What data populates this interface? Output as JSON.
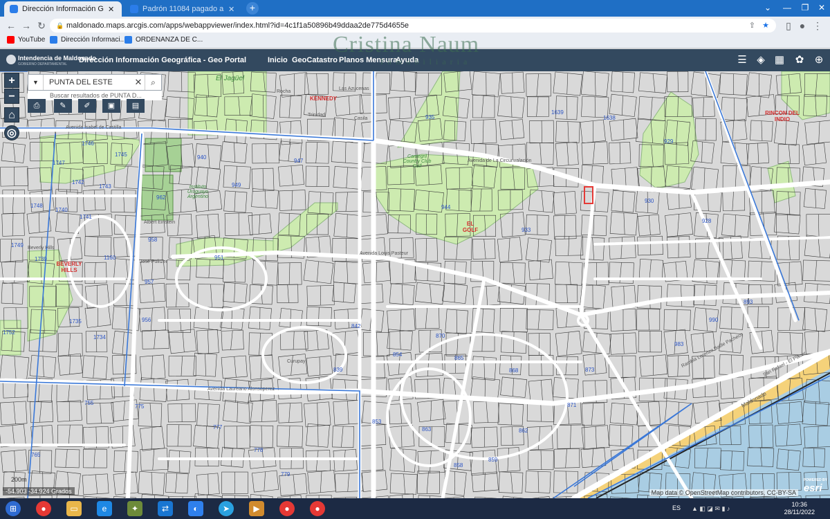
{
  "browser": {
    "tabs": [
      {
        "label": "Dirección Información Geográfica",
        "active": true
      },
      {
        "label": "Padrón 11084 pagado a su favor",
        "active": false
      }
    ],
    "url": "maldonado.maps.arcgis.com/apps/webappviewer/index.html?id=4c1f1a50896b49ddaa2de775d4655e",
    "bookmarks": [
      "YouTube",
      "Dirección Informaci...",
      "ORDENANZA DE C..."
    ]
  },
  "watermark": {
    "name": "Cristina Naum",
    "sub": "Inmobiliaria"
  },
  "app": {
    "municipality": "Intendencia de Maldonado",
    "municipality_sub": "GOBIERNO DEPARTAMENTAL",
    "title": "Dirección Información Geográfica - Geo Portal",
    "nav": [
      "Inicio",
      "GeoCatastro",
      "Planos Mensura",
      "Ayuda"
    ]
  },
  "search": {
    "value": "PUNTA DEL ESTE",
    "suggestion": "Buscar resultados de PUNTA D..."
  },
  "map": {
    "places": [
      {
        "text": "KENNEDY"
      },
      {
        "text": "RINCON DEL INDIO"
      },
      {
        "text": "BEVERLY HILLS"
      },
      {
        "text": "EL GOLF"
      }
    ],
    "green_labels": [
      "El Jagüel",
      "Cantegril Country Club Golf",
      "Instituto Uruguayo Argentino"
    ],
    "streets": [
      "Avenida Isabel de Castilla",
      "Avenida de La Circunvalación",
      "Avenida Laureano Alonsoperez",
      "Avenida Louis Pasteur",
      "Rambla Lorenzo Batlle Pacheco",
      "San Rafael - El Placer",
      "Maldonado",
      "Albert Einstein",
      "José Pulitzer",
      "Curupay",
      "Beverly Hills",
      "Rocha",
      "Trinidad",
      "Casila",
      "Las Azucenas"
    ],
    "parcels": [
      "1746",
      "1747",
      "1745",
      "1742",
      "1743",
      "1748",
      "1740",
      "1741",
      "1749",
      "1739",
      "1160",
      "962",
      "958",
      "957",
      "956",
      "951",
      "944",
      "935",
      "1639",
      "1638",
      "929",
      "930",
      "928",
      "933",
      "893",
      "990",
      "983",
      "1752",
      "1735",
      "1734",
      "755",
      "765",
      "775",
      "777",
      "778",
      "779",
      "853",
      "858",
      "859",
      "862",
      "863",
      "868",
      "873",
      "871",
      "842",
      "839",
      "854",
      "865",
      "870",
      "940",
      "949",
      "947"
    ],
    "scale": "200m",
    "coords": "-54.903 -34.924 Grados",
    "attribution": "Map data © OpenStreetMap contributors, CC-BY-SA",
    "esri": "esri",
    "esri_powered": "POWERED BY"
  },
  "taskbar": {
    "lang": "ES",
    "time": "10:36",
    "date": "28/11/2022"
  },
  "colors": {
    "tabstrip": "#1f6fc5",
    "app_header": "#33495f",
    "park_green": "#cdebb0",
    "parcel_line": "#2d2d2d",
    "road": "#ffffff",
    "beach": "#f5d27a",
    "sea": "#a9cde3",
    "boundary_blue": "#3a78d8"
  }
}
